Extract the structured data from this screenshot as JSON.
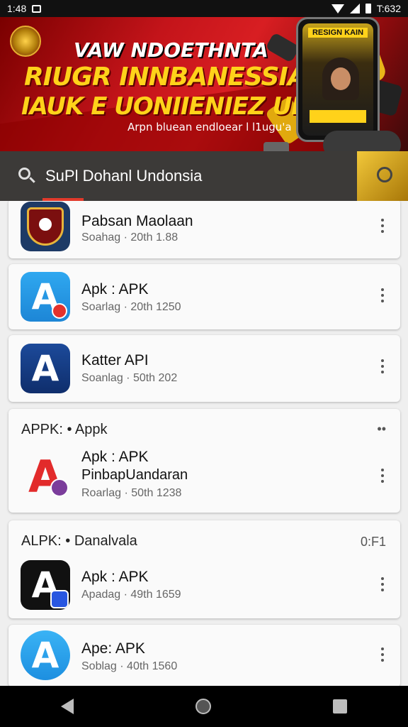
{
  "status_bar": {
    "time": "1:48",
    "right_time": "T:632"
  },
  "banner": {
    "line1": "VAW NDOETHNTA",
    "line2": "RIUGR INNBANESSIAN",
    "line3": "IAUK E UONIIENIEZ UM?",
    "subtitle": "Arpn bluean endloear l l1ugu'a",
    "phone_title": "RESIGN KAIN"
  },
  "search": {
    "query": "SuPl Dohanl Undonsia"
  },
  "cards": [
    {
      "apps": [
        {
          "name": "Pabsan Maolaan",
          "meta": "Soahag · 20th 1.88",
          "icon": "emblem-icon"
        }
      ]
    },
    {
      "apps": [
        {
          "name": "Apk : APK",
          "meta": "Soarlag · 20th 1250",
          "icon": "apk-blue-icon"
        }
      ]
    },
    {
      "apps": [
        {
          "name": "Katter API",
          "meta": "Soanlag · 50th 202",
          "icon": "apk-darkblue-icon"
        }
      ]
    },
    {
      "section_title": "APPK: • Appk",
      "section_right": "••",
      "apps": [
        {
          "name": "Apk : APK",
          "subname": "PinbapUandaran",
          "meta": "Roarlag · 50th 1238",
          "icon": "apk-red-icon"
        }
      ]
    },
    {
      "section_title": "ALPK: • Danalvala",
      "section_right": "0:F1",
      "apps": [
        {
          "name": "Apk : APK",
          "meta": "Apadag · 49th 1659",
          "icon": "apk-black-icon"
        }
      ]
    },
    {
      "apps": [
        {
          "name": "Ape: APK",
          "meta": "Soblag · 40th 1560",
          "icon": "apk-lightblue-icon"
        }
      ]
    }
  ],
  "nav": {
    "back": "back-icon",
    "home": "home-icon",
    "recent": "recents-icon"
  }
}
